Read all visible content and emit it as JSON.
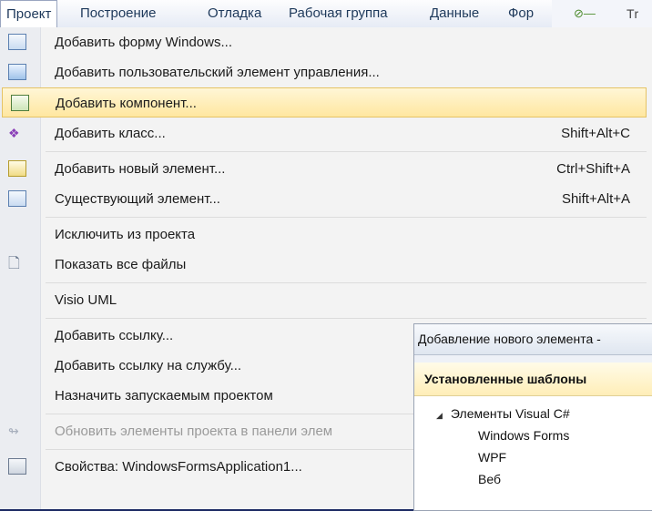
{
  "menubar": {
    "items": [
      "Проект",
      "Построение",
      "Отладка",
      "Рабочая группа",
      "Данные",
      "Фор"
    ],
    "extra_text": "Тr"
  },
  "menu": {
    "items": [
      {
        "label": "Добавить форму Windows...",
        "shortcut": "",
        "icon": "windows-form-icon"
      },
      {
        "label": "Добавить пользовательский элемент управления...",
        "shortcut": "",
        "icon": "user-control-icon"
      },
      {
        "label": "Добавить компонент...",
        "shortcut": "",
        "icon": "component-icon",
        "highlighted": true
      },
      {
        "label": "Добавить класс...",
        "shortcut": "Shift+Alt+C",
        "icon": "class-icon"
      },
      {
        "label": "Добавить новый элемент...",
        "shortcut": "Ctrl+Shift+A",
        "icon": "new-item-icon"
      },
      {
        "label": "Существующий элемент...",
        "shortcut": "Shift+Alt+A",
        "icon": "existing-item-icon"
      },
      {
        "label": "Исключить из проекта",
        "shortcut": ""
      },
      {
        "label": "Показать все файлы",
        "shortcut": "",
        "icon": "show-all-files-icon"
      },
      {
        "label": "Visio UML",
        "shortcut": "",
        "submenu": true
      },
      {
        "label": "Добавить ссылку...",
        "shortcut": ""
      },
      {
        "label": "Добавить ссылку на службу...",
        "shortcut": ""
      },
      {
        "label": "Назначить запускаемым проектом",
        "shortcut": ""
      },
      {
        "label": "Обновить элементы проекта в панели элем",
        "shortcut": "",
        "disabled": true,
        "icon": "refresh-toolbox-icon"
      },
      {
        "label": "Свойства: WindowsFormsApplication1...",
        "shortcut": "",
        "icon": "properties-icon"
      }
    ]
  },
  "dialog": {
    "title": "Добавление нового элемента -",
    "section_header": "Установленные шаблоны",
    "tree": [
      {
        "label": "Элементы Visual C#",
        "expanded": true,
        "level": 0
      },
      {
        "label": "Windows Forms",
        "level": 1
      },
      {
        "label": "WPF",
        "level": 1
      },
      {
        "label": "Веб",
        "level": 1
      }
    ],
    "tree_expand_glyph": "◢"
  }
}
